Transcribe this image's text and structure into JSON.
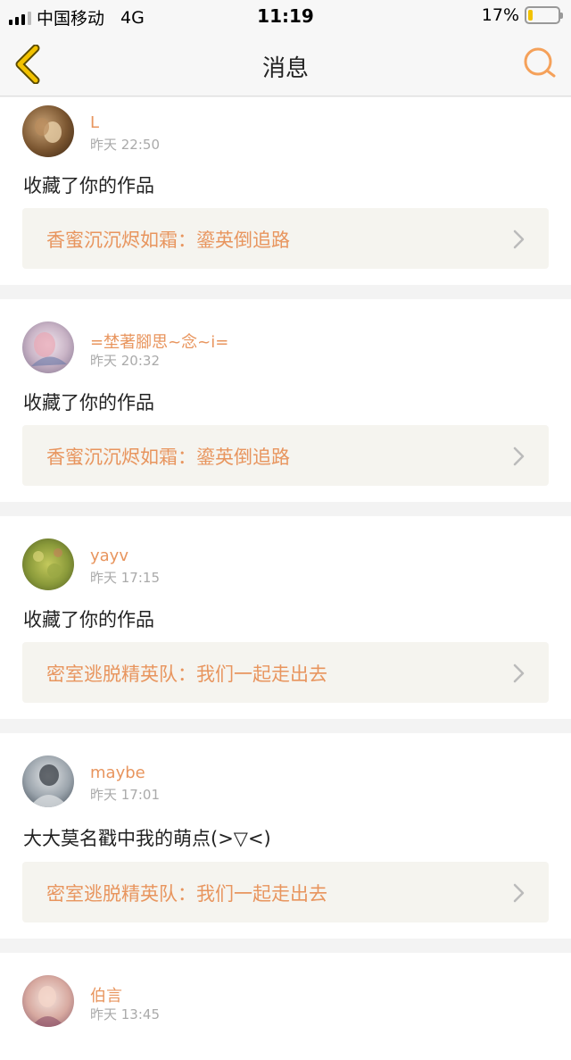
{
  "status_bar": {
    "carrier": "中国移动",
    "network": "4G",
    "time": "11:19",
    "battery": "17%",
    "battery_level": 0.17
  },
  "header": {
    "title": "消息",
    "back_icon": "chevron-left-icon",
    "search_icon": "search-icon"
  },
  "colors": {
    "accent": "#e8955e",
    "back_icon": "#f2c200",
    "search_icon": "#f5a15a"
  },
  "messages": [
    {
      "user": "L",
      "time": "昨天 22:50",
      "text": "收藏了你的作品",
      "work": "香蜜沉沉烬如霜：鎏英倒追路"
    },
    {
      "user": "=埜著腳思~念~i=",
      "time": "昨天 20:32",
      "text": "收藏了你的作品",
      "work": "香蜜沉沉烬如霜：鎏英倒追路"
    },
    {
      "user": "yayv",
      "time": "昨天 17:15",
      "text": "收藏了你的作品",
      "work": "密室逃脱精英队：我们一起走出去"
    },
    {
      "user": "maybe",
      "time": "昨天 17:01",
      "text": "大大莫名戳中我的萌点(>▽<)",
      "work": "密室逃脱精英队：我们一起走出去"
    },
    {
      "user": "伯言",
      "time": "昨天 13:45",
      "text": "",
      "work": ""
    }
  ]
}
